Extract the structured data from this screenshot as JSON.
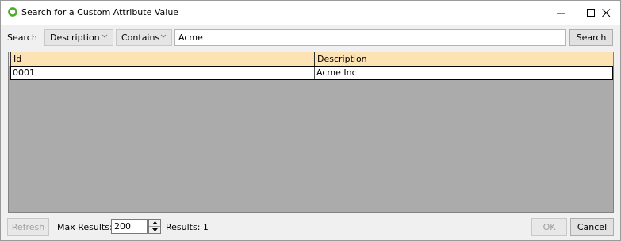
{
  "window": {
    "title": "Search for a Custom Attribute Value",
    "icon": "green-ring-icon",
    "accent": "#4caf28"
  },
  "toolbar": {
    "search_label": "Search",
    "field_dropdown": {
      "selected": "Description"
    },
    "operator_dropdown": {
      "selected": "Contains"
    },
    "search_value": "Acme",
    "search_button": "Search"
  },
  "grid": {
    "header_color": "#fde3b4",
    "columns": [
      "Id",
      "Description"
    ],
    "rows": [
      {
        "id": "0001",
        "description": "Acme Inc"
      }
    ]
  },
  "footer": {
    "refresh_button": "Refresh",
    "max_results_label": "Max Results:",
    "max_results_value": "200",
    "results_label": "Results: 1",
    "ok_button": "OK",
    "cancel_button": "Cancel"
  }
}
